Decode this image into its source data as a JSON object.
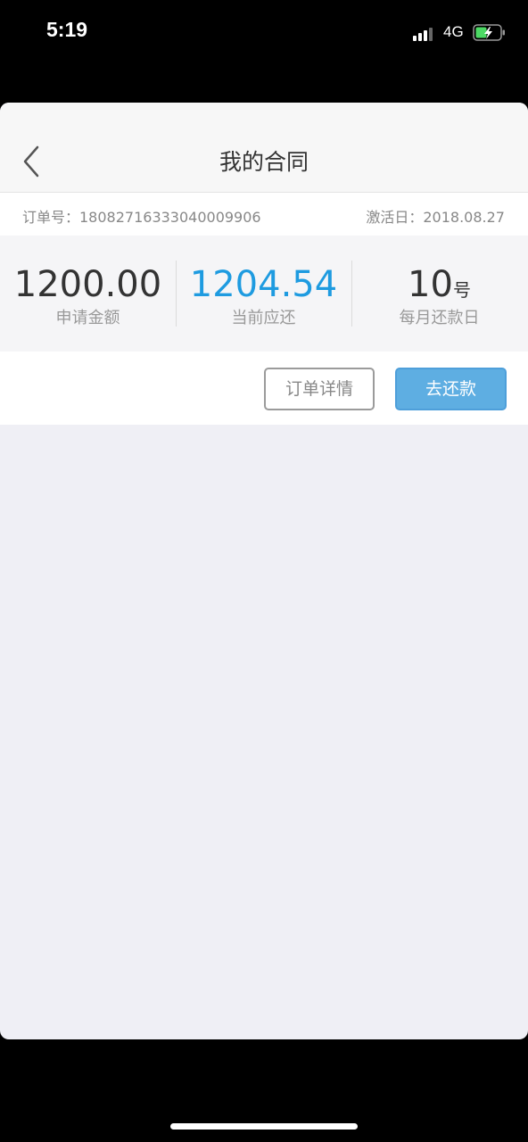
{
  "status_bar": {
    "time": "5:19",
    "network": "4G"
  },
  "nav": {
    "title": "我的合同"
  },
  "order": {
    "order_number_label": "订单号：1808271633304000990​6",
    "activation_label": "激活日：2018.08.27"
  },
  "stats": [
    {
      "value": "1200.00",
      "unit": "",
      "label": "申请金额"
    },
    {
      "value": "1204.54",
      "unit": "",
      "label": "当前应还"
    },
    {
      "value": "10",
      "unit": "号",
      "label": "每月还款日"
    }
  ],
  "actions": {
    "detail_label": "订单详情",
    "repay_label": "去还款"
  },
  "colors": {
    "accent": "#1e9be0",
    "button": "#5eaee2"
  }
}
